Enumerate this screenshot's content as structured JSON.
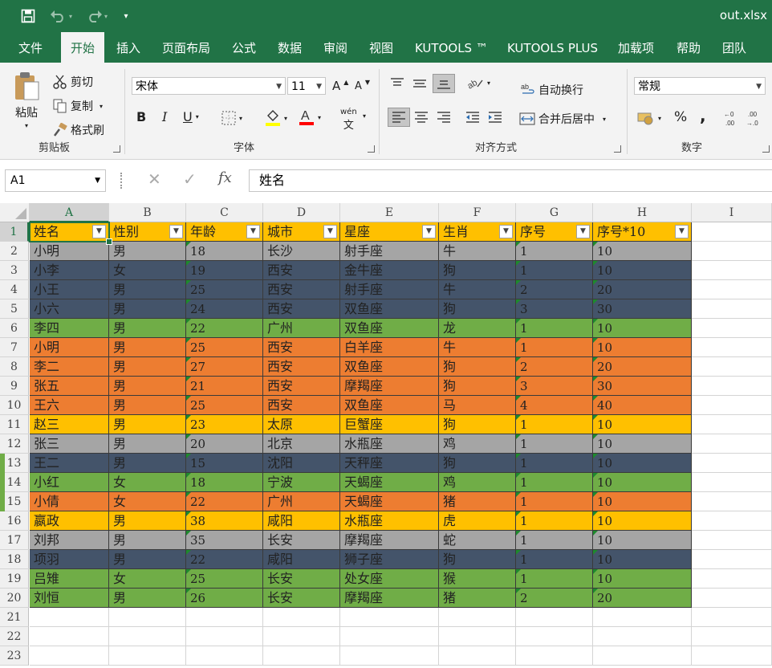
{
  "window": {
    "title": "out.xlsx"
  },
  "quick_access": {
    "save": "save-icon",
    "undo": "undo-icon",
    "redo": "redo-icon",
    "customize": "▾"
  },
  "tabs": [
    "文件",
    "开始",
    "插入",
    "页面布局",
    "公式",
    "数据",
    "审阅",
    "视图",
    "KUTOOLS ™",
    "KUTOOLS PLUS",
    "加载项",
    "帮助",
    "团队"
  ],
  "active_tab": "开始",
  "ribbon": {
    "clipboard": {
      "paste": "粘贴",
      "cut": "剪切",
      "copy": "复制",
      "format_painter": "格式刷",
      "label": "剪贴板"
    },
    "font": {
      "name": "宋体",
      "size": "11",
      "bold": "B",
      "italic": "I",
      "underline": "U",
      "label": "字体",
      "phonetic": "wén"
    },
    "alignment": {
      "wrap": "自动换行",
      "merge": "合并后居中",
      "label": "对齐方式"
    },
    "number": {
      "format": "常规",
      "percent": "%",
      "comma": ",",
      "label": "数字"
    }
  },
  "namebox": "A1",
  "formula": "姓名",
  "columns": [
    "A",
    "B",
    "C",
    "D",
    "E",
    "F",
    "G",
    "H",
    "I"
  ],
  "header": [
    "姓名",
    "性别",
    "年龄",
    "城市",
    "星座",
    "生肖",
    "序号",
    "序号*10"
  ],
  "colors": {
    "gray": "#a5a5a5",
    "navy": "#44546a",
    "green": "#70ad47",
    "orange": "#ed7d31",
    "gold": "#ffc000",
    "excel_green": "#217346"
  },
  "rows": [
    {
      "c": "gray",
      "v": [
        "小明",
        "男",
        "18",
        "长沙",
        "射手座",
        "牛",
        "1",
        "10"
      ]
    },
    {
      "c": "navy",
      "v": [
        "小李",
        "女",
        "19",
        "西安",
        "金牛座",
        "狗",
        "1",
        "10"
      ]
    },
    {
      "c": "navy",
      "v": [
        "小王",
        "男",
        "25",
        "西安",
        "射手座",
        "牛",
        "2",
        "20"
      ]
    },
    {
      "c": "navy",
      "v": [
        "小六",
        "男",
        "24",
        "西安",
        "双鱼座",
        "狗",
        "3",
        "30"
      ]
    },
    {
      "c": "green",
      "v": [
        "李四",
        "男",
        "22",
        "广州",
        "双鱼座",
        "龙",
        "1",
        "10"
      ]
    },
    {
      "c": "orange",
      "v": [
        "小明",
        "男",
        "25",
        "西安",
        "白羊座",
        "牛",
        "1",
        "10"
      ]
    },
    {
      "c": "orange",
      "v": [
        "李二",
        "男",
        "27",
        "西安",
        "双鱼座",
        "狗",
        "2",
        "20"
      ]
    },
    {
      "c": "orange",
      "v": [
        "张五",
        "男",
        "21",
        "西安",
        "摩羯座",
        "狗",
        "3",
        "30"
      ]
    },
    {
      "c": "orange",
      "v": [
        "王六",
        "男",
        "25",
        "西安",
        "双鱼座",
        "马",
        "4",
        "40"
      ]
    },
    {
      "c": "gold",
      "v": [
        "赵三",
        "男",
        "23",
        "太原",
        "巨蟹座",
        "狗",
        "1",
        "10"
      ]
    },
    {
      "c": "gray",
      "v": [
        "张三",
        "男",
        "20",
        "北京",
        "水瓶座",
        "鸡",
        "1",
        "10"
      ]
    },
    {
      "c": "navy",
      "v": [
        "王二",
        "男",
        "15",
        "沈阳",
        "天秤座",
        "狗",
        "1",
        "10"
      ]
    },
    {
      "c": "green",
      "v": [
        "小红",
        "女",
        "18",
        "宁波",
        "天蝎座",
        "鸡",
        "1",
        "10"
      ]
    },
    {
      "c": "orange",
      "v": [
        "小倩",
        "女",
        "22",
        "广州",
        "天蝎座",
        "猪",
        "1",
        "10"
      ]
    },
    {
      "c": "gold",
      "v": [
        "嬴政",
        "男",
        "38",
        "咸阳",
        "水瓶座",
        "虎",
        "1",
        "10"
      ]
    },
    {
      "c": "gray",
      "v": [
        "刘邦",
        "男",
        "35",
        "长安",
        "摩羯座",
        "蛇",
        "1",
        "10"
      ]
    },
    {
      "c": "navy",
      "v": [
        "项羽",
        "男",
        "22",
        "咸阳",
        "狮子座",
        "狗",
        "1",
        "10"
      ]
    },
    {
      "c": "green",
      "v": [
        "吕雉",
        "女",
        "25",
        "长安",
        "处女座",
        "猴",
        "1",
        "10"
      ]
    },
    {
      "c": "green",
      "v": [
        "刘恒",
        "男",
        "26",
        "长安",
        "摩羯座",
        "猪",
        "2",
        "20"
      ]
    }
  ],
  "row_numbers": [
    "1",
    "2",
    "3",
    "4",
    "5",
    "6",
    "7",
    "8",
    "9",
    "10",
    "11",
    "12",
    "13",
    "14",
    "15",
    "16",
    "17",
    "18",
    "19",
    "20",
    "21",
    "22",
    "23"
  ]
}
